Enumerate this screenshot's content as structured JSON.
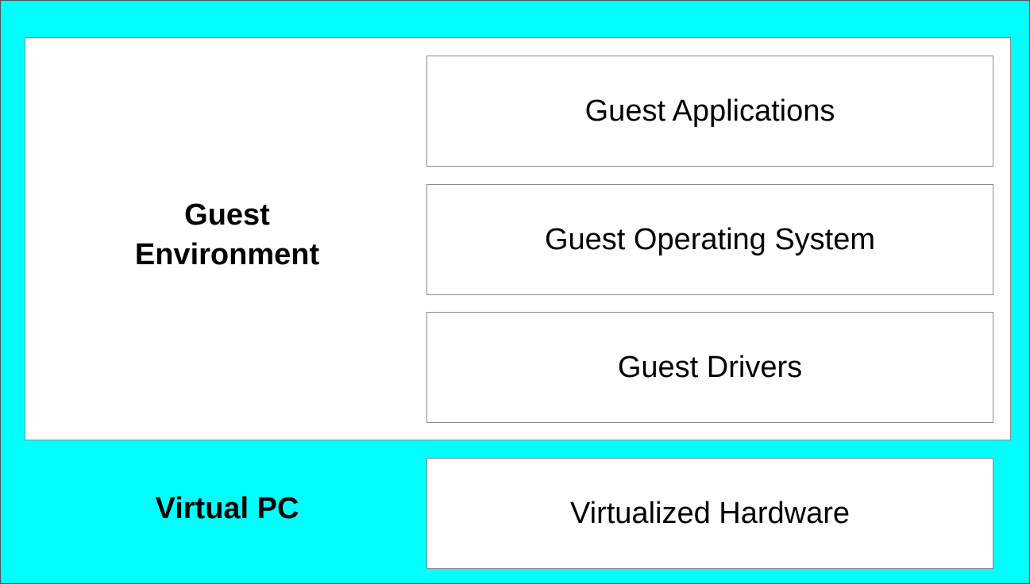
{
  "colors": {
    "background": "#00ffff",
    "box_fill": "#ffffff",
    "box_border": "#8a8a8a",
    "outer_border": "#555555",
    "text": "#000000"
  },
  "guest_environment": {
    "label_line1": "Guest",
    "label_line2": "Environment",
    "layers": [
      {
        "label": "Guest Applications"
      },
      {
        "label": "Guest Operating System"
      },
      {
        "label": "Guest Drivers"
      }
    ]
  },
  "virtual_pc": {
    "label": "Virtual PC",
    "layer": {
      "label": "Virtualized Hardware"
    }
  }
}
